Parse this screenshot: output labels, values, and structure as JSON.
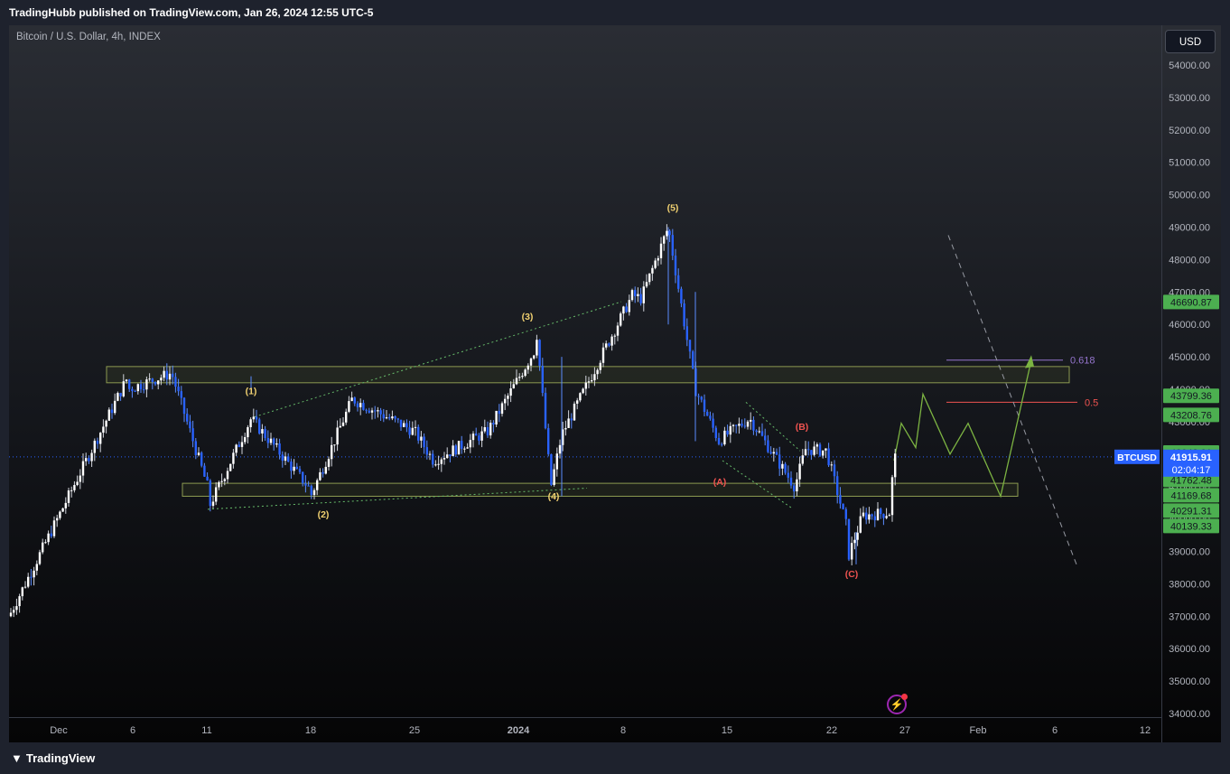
{
  "header": {
    "published": "TradingHubb published on TradingView.com, Jan 26, 2024 12:55 UTC-5"
  },
  "chart": {
    "symbol_title": "Bitcoin / U.S. Dollar, 4h, INDEX",
    "currency": "USD",
    "footer_logo": "TradingView"
  },
  "chart_data": {
    "type": "candlestick",
    "symbol": "BTCUSD",
    "interval": "4h",
    "ylim": [
      34000,
      55000
    ],
    "y_ticks": [
      34000,
      35000,
      36000,
      37000,
      38000,
      39000,
      40000,
      41000,
      43000,
      44000,
      45000,
      46000,
      47000,
      48000,
      49000,
      50000,
      51000,
      52000,
      53000,
      54000
    ],
    "x_ticks": [
      "Dec",
      "6",
      "11",
      "18",
      "25",
      "2024",
      "8",
      "15",
      "22",
      "27",
      "Feb",
      "6",
      "12"
    ],
    "price_labels": [
      {
        "value": "46690.87",
        "color": "#4caf50"
      },
      {
        "value": "43799.36",
        "color": "#4caf50"
      },
      {
        "value": "43208.76",
        "color": "#4caf50"
      },
      {
        "value": "42048.91",
        "color": "#4caf50"
      },
      {
        "value": "41762.48",
        "color": "#4caf50"
      },
      {
        "value": "41169.68",
        "color": "#4caf50"
      },
      {
        "value": "40291.31",
        "color": "#4caf50"
      },
      {
        "value": "40139.33",
        "color": "#4caf50"
      }
    ],
    "last_price": {
      "symbol": "BTCUSD",
      "value": "41915.91",
      "countdown": "02:04:17",
      "color": "#2962ff"
    },
    "wave_labels": [
      "(1)",
      "(2)",
      "(3)",
      "(4)",
      "(5)",
      "(A)",
      "(B)",
      "(C)"
    ],
    "fib_levels": [
      {
        "label": "0.618",
        "value": 44900,
        "color": "#9575cd"
      },
      {
        "label": "0.5",
        "value": 43600,
        "color": "#ef5350"
      }
    ],
    "zones": [
      {
        "from": 44200,
        "to": 44700
      },
      {
        "from": 40700,
        "to": 41100
      }
    ],
    "anchor_candles": [
      {
        "date": "Dec",
        "value": 37000
      },
      {
        "date": "6",
        "value": 44000
      },
      {
        "date": "11",
        "value": 40800
      },
      {
        "date": "18",
        "value": 40900
      },
      {
        "date": "25",
        "value": 42700
      },
      {
        "date": "2024",
        "value": 45300
      },
      {
        "date": "8",
        "value": 46800
      },
      {
        "date": "15",
        "value": 42400
      },
      {
        "date": "22",
        "value": 39500
      },
      {
        "date": "27",
        "value": 41900
      }
    ]
  }
}
